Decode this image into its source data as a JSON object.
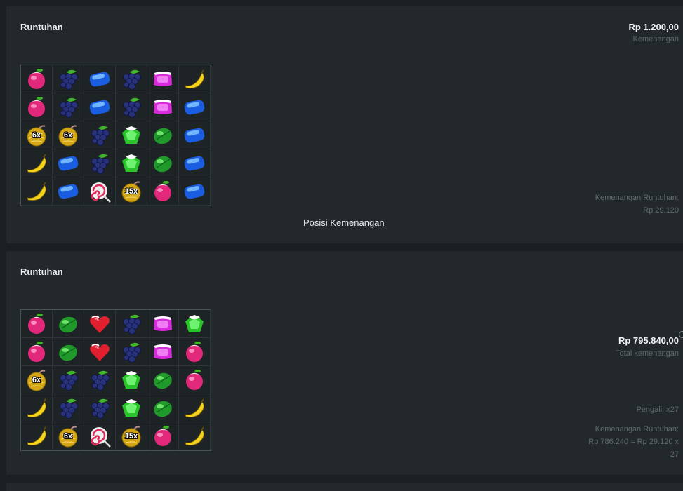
{
  "rounds": [
    {
      "title": "Runtuhan",
      "win_amount": "Rp 1.200,00",
      "win_label": "Kemenangan",
      "cascade_label": "Kemenangan Runtuhan:",
      "cascade_value": "Rp 29.120",
      "link": "Posisi Kemenangan",
      "grid": [
        [
          {
            "s": "apple"
          },
          {
            "s": "grape"
          },
          {
            "s": "blue"
          },
          {
            "s": "grape"
          },
          {
            "s": "purple"
          },
          {
            "s": "banana"
          }
        ],
        [
          {
            "s": "apple"
          },
          {
            "s": "grape"
          },
          {
            "s": "blue"
          },
          {
            "s": "grape"
          },
          {
            "s": "purple"
          },
          {
            "s": "blue"
          }
        ],
        [
          {
            "s": "bomb",
            "m": "6x"
          },
          {
            "s": "bomb",
            "m": "6x"
          },
          {
            "s": "grape"
          },
          {
            "s": "greenpent"
          },
          {
            "s": "plum"
          },
          {
            "s": "blue"
          }
        ],
        [
          {
            "s": "banana"
          },
          {
            "s": "blue"
          },
          {
            "s": "grape"
          },
          {
            "s": "greenpent"
          },
          {
            "s": "plum"
          },
          {
            "s": "blue"
          }
        ],
        [
          {
            "s": "banana"
          },
          {
            "s": "blue"
          },
          {
            "s": "lolli"
          },
          {
            "s": "bomb",
            "m": "15x"
          },
          {
            "s": "apple"
          },
          {
            "s": "blue"
          }
        ]
      ]
    },
    {
      "title": "Runtuhan",
      "total_amount": "Rp 795.840,00",
      "total_label": "Total kemenangan",
      "multiplier": "Pengali: x27",
      "cascade_line1": "Kemenangan Runtuhan:",
      "cascade_line2": "Rp 786.240 = Rp 29.120 x",
      "cascade_line3": "27",
      "grid": [
        [
          {
            "s": "apple"
          },
          {
            "s": "plum"
          },
          {
            "s": "heart"
          },
          {
            "s": "grape"
          },
          {
            "s": "purple"
          },
          {
            "s": "greenpent"
          }
        ],
        [
          {
            "s": "apple"
          },
          {
            "s": "plum"
          },
          {
            "s": "heart"
          },
          {
            "s": "grape"
          },
          {
            "s": "purple"
          },
          {
            "s": "apple"
          }
        ],
        [
          {
            "s": "bomb",
            "m": "6x"
          },
          {
            "s": "grape"
          },
          {
            "s": "grape"
          },
          {
            "s": "greenpent"
          },
          {
            "s": "plum"
          },
          {
            "s": "apple"
          }
        ],
        [
          {
            "s": "banana"
          },
          {
            "s": "grape"
          },
          {
            "s": "grape"
          },
          {
            "s": "greenpent"
          },
          {
            "s": "plum"
          },
          {
            "s": "banana"
          }
        ],
        [
          {
            "s": "banana"
          },
          {
            "s": "bomb",
            "m": "6x"
          },
          {
            "s": "lolli"
          },
          {
            "s": "bomb",
            "m": "15x"
          },
          {
            "s": "apple"
          },
          {
            "s": "banana"
          }
        ]
      ]
    }
  ]
}
